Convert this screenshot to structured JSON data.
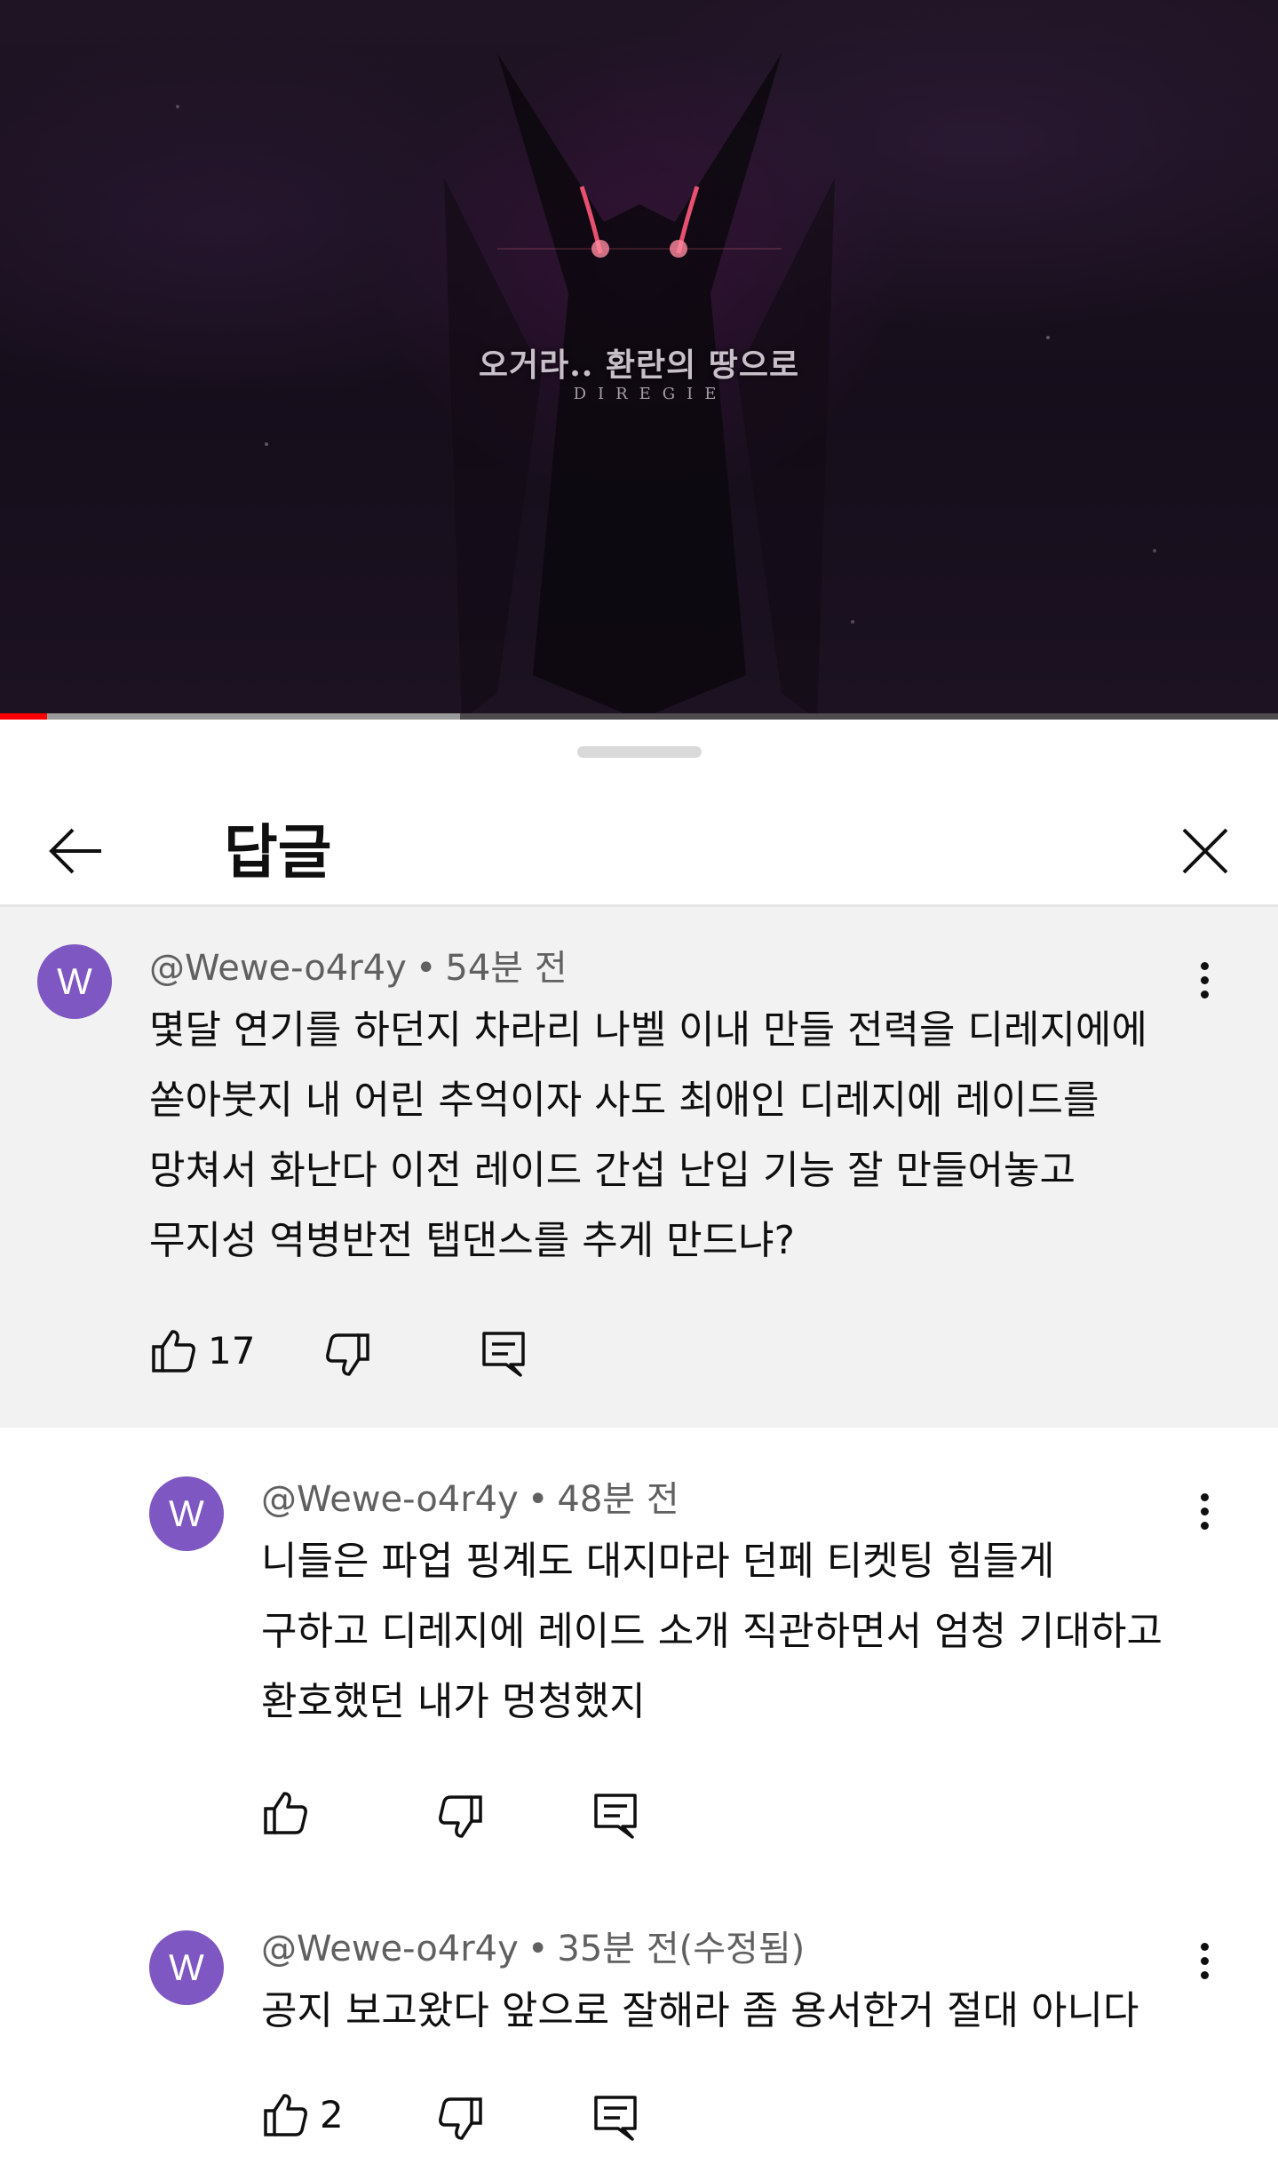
{
  "video": {
    "title": "오거라.. 환란의 땅으로",
    "subtitle": "DIREGIE",
    "progress_played": 0.037,
    "progress_buffered": 0.36
  },
  "header": {
    "title": "답글",
    "back_icon": "arrow-left-icon",
    "close_icon": "close-icon"
  },
  "comments": [
    {
      "avatar_letter": "W",
      "handle": "@Wewe-o4r4y",
      "separator": "•",
      "time": "54분 전",
      "lines": [
        "몇달 연기를 하던지 차라리 나벨 이내 만들 전력을 디레지에에",
        "쏟아붓지 내 어린 추억이자 사도 최애인 디레지에 레이드를",
        "망쳐서 화난다 이전 레이드 간섭 난입 기능 잘 만들어놓고",
        "무지성 역병반전 탭댄스를 추게 만드냐?"
      ],
      "likes": "17"
    },
    {
      "avatar_letter": "W",
      "handle": "@Wewe-o4r4y",
      "separator": "•",
      "time": "48분 전",
      "lines": [
        "니들은 파업 핑계도 대지마라 던페 티켓팅 힘들게",
        "구하고 디레지에 레이드 소개 직관하면서 엄청 기대하고",
        "환호했던 내가 멍청했지"
      ],
      "likes": ""
    },
    {
      "avatar_letter": "W",
      "handle": "@Wewe-o4r4y",
      "separator": "•",
      "time": "35분 전(수정됨)",
      "lines": [
        "공지 보고왔다 앞으로 잘해라 좀 용서한거 절대 아니다"
      ],
      "likes": "2"
    }
  ],
  "colors": {
    "avatar_bg": "#7e57c2",
    "highlight_bg": "#f2f2f2",
    "progress": "#ff0000"
  }
}
